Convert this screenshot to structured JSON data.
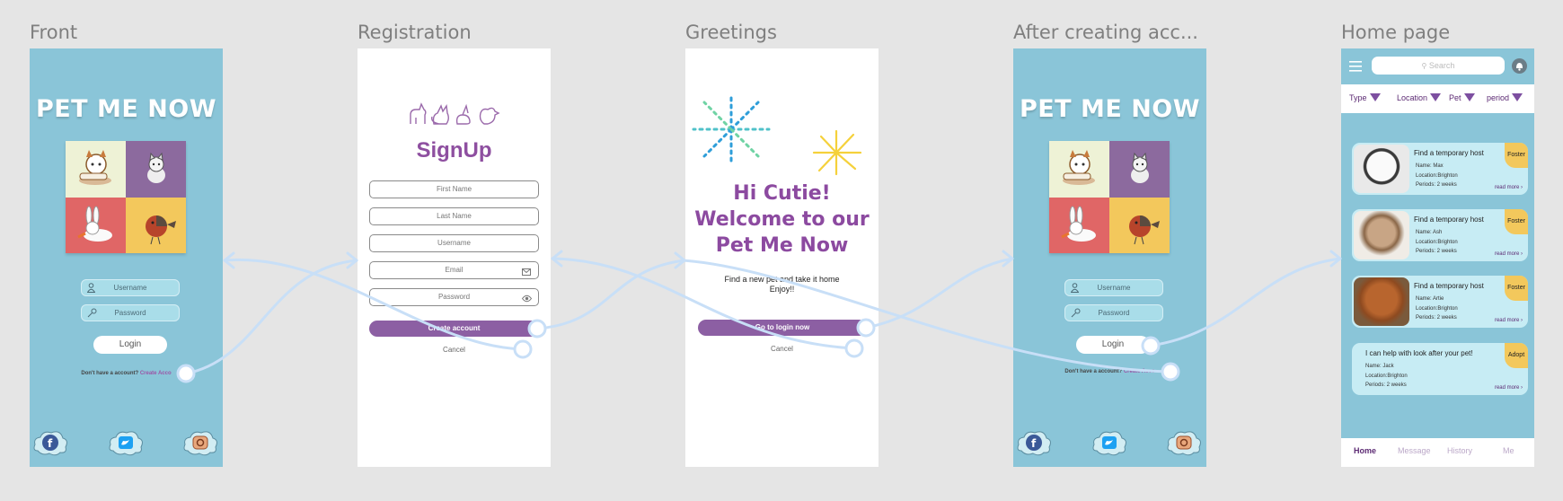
{
  "frames": {
    "front": {
      "title": "Front"
    },
    "registration": {
      "title": "Registration"
    },
    "greetings": {
      "title": "Greetings"
    },
    "after": {
      "title": "After creating acc..."
    },
    "home": {
      "title": "Home page"
    }
  },
  "login": {
    "brand": "PET ME NOW",
    "username_placeholder": "Username",
    "password_placeholder": "Password",
    "login_label": "Login",
    "no_account_text": "Don't have a account?",
    "create_link": "Create Acco"
  },
  "registration": {
    "title": "SignUp",
    "fields": [
      "First Name",
      "Last Name",
      "Username",
      "Email",
      "Password"
    ],
    "create_button": "Create account",
    "cancel": "Cancel"
  },
  "greetings": {
    "line1": "Hi Cutie!",
    "line2": "Welcome to our",
    "line3": "Pet Me Now",
    "sub1": "Find a new pet and take it home",
    "sub2": "Enjoy!!",
    "login_button": "Go to login now",
    "cancel": "Cancel"
  },
  "home": {
    "search_placeholder": "Search",
    "filters": [
      "Type",
      "Location",
      "Pet",
      "period"
    ],
    "cards": [
      {
        "title": "Find a temporary host",
        "name": "Name: Max",
        "location": "Location:Brighton",
        "periods": "Periods: 2 weeks",
        "badge": "Foster",
        "readmore": "read more"
      },
      {
        "title": "Find a temporary host",
        "name": "Name: Ash",
        "location": "Location:Brighton",
        "periods": "Periods: 2 weeks",
        "badge": "Foster",
        "readmore": "read more"
      },
      {
        "title": "Find a temporary host",
        "name": "Name: Artie",
        "location": "Location:Brighton",
        "periods": "Periods: 2 weeks",
        "badge": "Foster",
        "readmore": "read more"
      },
      {
        "title": "I can help with look after your pet!",
        "name": "Name: Jack",
        "location": "Location:Brighton",
        "periods": "Periods: 2 weeks",
        "badge": "Adopt",
        "readmore": "read more"
      }
    ],
    "nav": [
      "Home",
      "Message",
      "History",
      "Me"
    ]
  },
  "colors": {
    "frame_blue": "#8ac5d8",
    "accent_purple": "#8c5fa3",
    "flow_line": "#c8dff7",
    "badge_yellow": "#f3c85c"
  }
}
